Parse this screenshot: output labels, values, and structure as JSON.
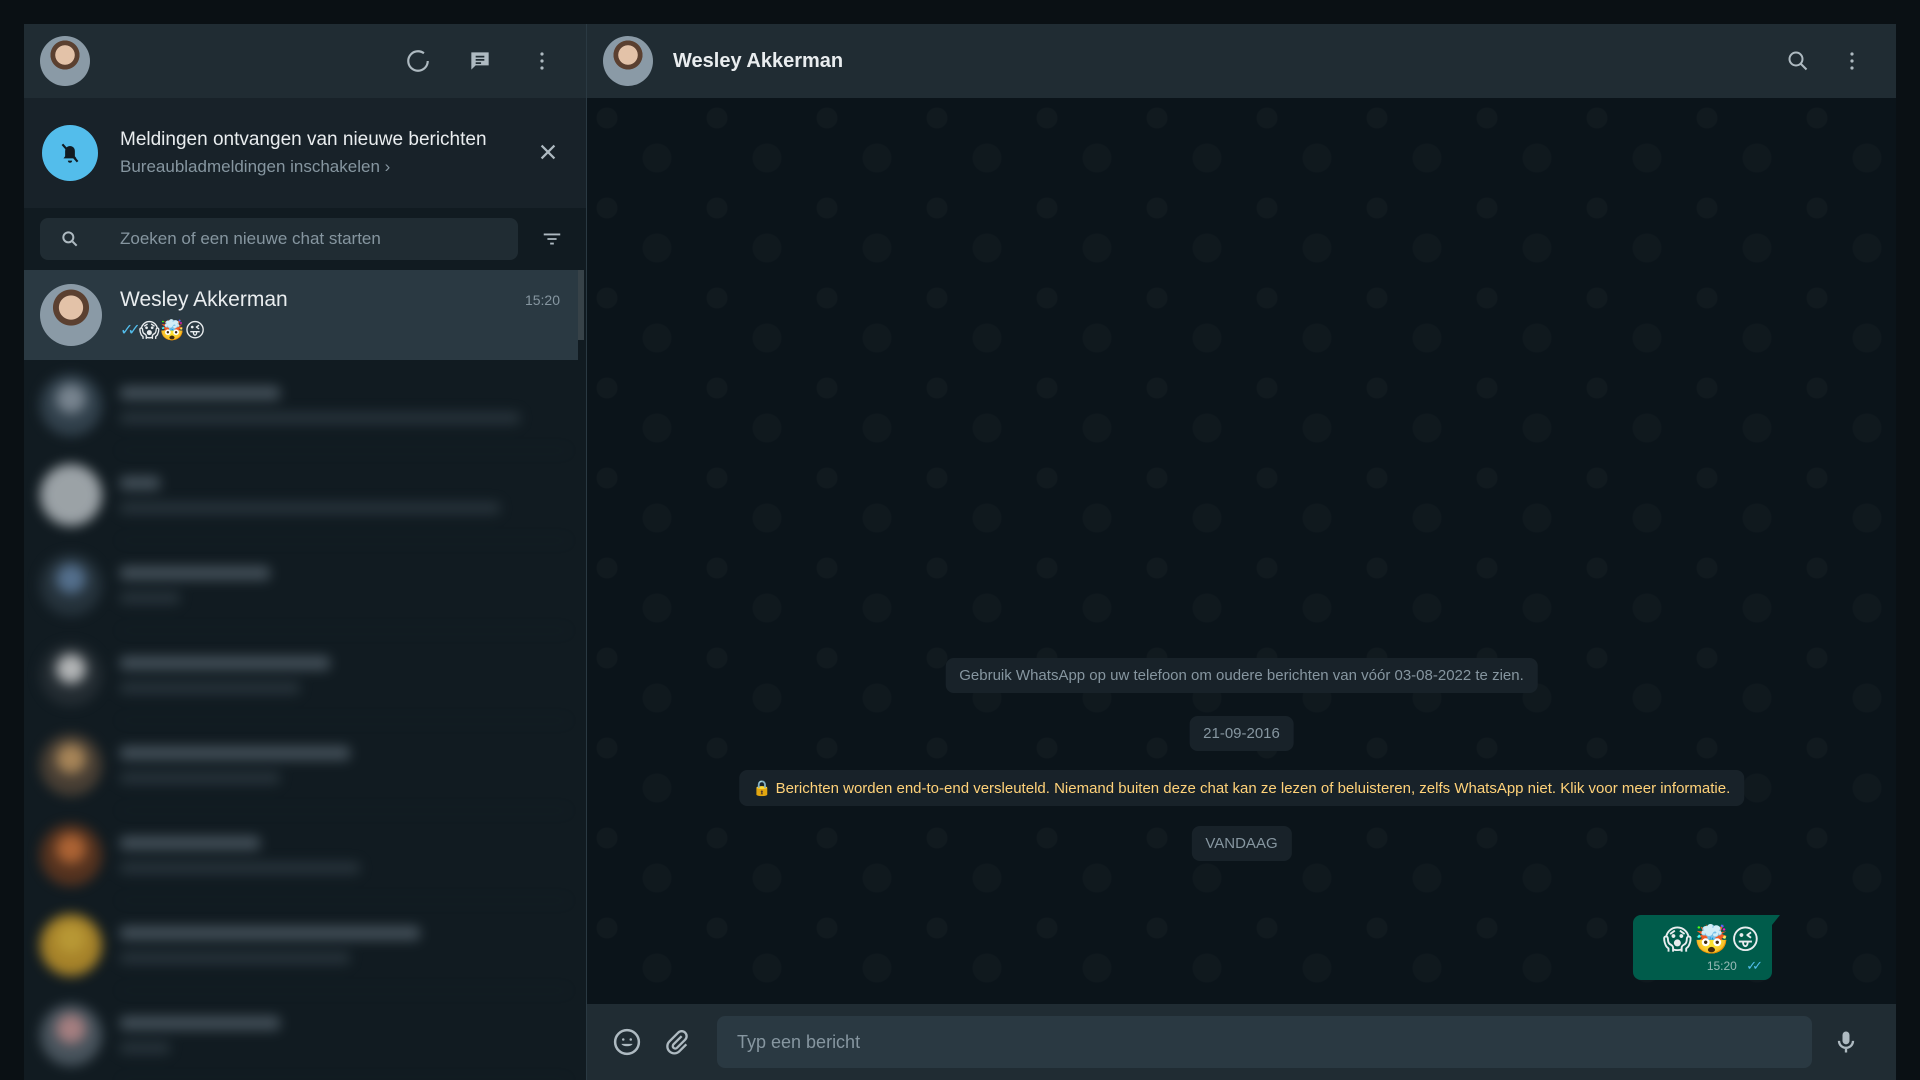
{
  "sidebar": {
    "header": {
      "icons": [
        "status-icon",
        "new-chat-icon",
        "menu-icon"
      ]
    },
    "notification": {
      "title": "Meldingen ontvangen van nieuwe berichten",
      "subtitle": "Bureaubladmeldingen inschakelen",
      "chevron": "›"
    },
    "search": {
      "placeholder": "Zoeken of een nieuwe chat starten"
    },
    "active_chat": {
      "name": "Wesley Akkerman",
      "time": "15:20",
      "ticks": "✓✓",
      "preview": "😱🤯😜"
    },
    "blurred_chat_count": 8
  },
  "conversation": {
    "header": {
      "name": "Wesley Akkerman",
      "icons": [
        "search-icon",
        "menu-icon"
      ]
    },
    "system_messages": {
      "older_info": "Gebruik WhatsApp op uw telefoon om oudere berichten van vóór 03-08-2022 te zien.",
      "date_1": "21-09-2016",
      "encryption": "🔒 Berichten worden end-to-end versleuteld. Niemand buiten deze chat kan ze lezen of beluisteren, zelfs WhatsApp niet. Klik voor meer informatie.",
      "date_2": "VANDAAG"
    },
    "outgoing_message": {
      "text": "😱🤯😜",
      "time": "15:20",
      "ticks": "✓✓"
    },
    "composer": {
      "placeholder": "Typ een bericht"
    }
  },
  "colors": {
    "accent_blue": "#53bdeb",
    "outgoing_bubble": "#005c4b",
    "panel": "#202c33",
    "background": "#111b21",
    "encryption_text": "#ffd279"
  }
}
